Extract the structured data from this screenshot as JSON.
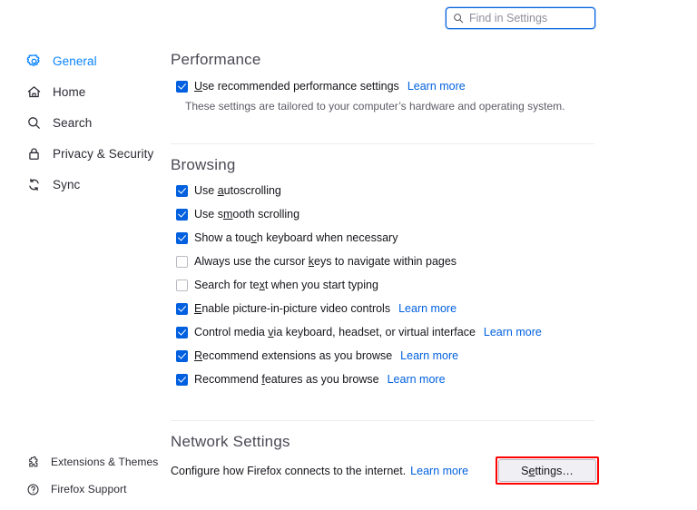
{
  "search": {
    "placeholder": "Find in Settings",
    "value": "",
    "icon": "search-icon"
  },
  "sidebar": {
    "items": [
      {
        "label": "General",
        "icon": "gear-icon",
        "active": true
      },
      {
        "label": "Home",
        "icon": "home-icon",
        "active": false
      },
      {
        "label": "Search",
        "icon": "search-icon",
        "active": false
      },
      {
        "label": "Privacy & Security",
        "icon": "lock-icon",
        "active": false
      },
      {
        "label": "Sync",
        "icon": "sync-icon",
        "active": false
      }
    ],
    "bottom_items": [
      {
        "label": "Extensions & Themes",
        "icon": "puzzle-piece-icon"
      },
      {
        "label": "Firefox Support",
        "icon": "question-circle-icon"
      }
    ]
  },
  "performance": {
    "heading": "Performance",
    "checkbox": {
      "label_pre": "",
      "accesskey": "U",
      "label_post": "se recommended performance settings",
      "checked": true,
      "learn_more": "Learn more"
    },
    "description": "These settings are tailored to your computer’s hardware and operating system."
  },
  "browsing": {
    "heading": "Browsing",
    "options": [
      {
        "pre": "Use ",
        "accesskey": "a",
        "post": "utoscrolling",
        "checked": true,
        "learn_more": ""
      },
      {
        "pre": "Use s",
        "accesskey": "m",
        "post": "ooth scrolling",
        "checked": true,
        "learn_more": ""
      },
      {
        "pre": "Show a tou",
        "accesskey": "c",
        "post": "h keyboard when necessary",
        "checked": true,
        "learn_more": ""
      },
      {
        "pre": "Always use the cursor ",
        "accesskey": "k",
        "post": "eys to navigate within pages",
        "checked": false,
        "learn_more": ""
      },
      {
        "pre": "Search for te",
        "accesskey": "x",
        "post": "t when you start typing",
        "checked": false,
        "learn_more": ""
      },
      {
        "pre": "",
        "accesskey": "E",
        "post": "nable picture-in-picture video controls",
        "checked": true,
        "learn_more": "Learn more"
      },
      {
        "pre": "Control media ",
        "accesskey": "v",
        "post": "ia keyboard, headset, or virtual interface",
        "checked": true,
        "learn_more": "Learn more"
      },
      {
        "pre": "",
        "accesskey": "R",
        "post": "ecommend extensions as you browse",
        "checked": true,
        "learn_more": "Learn more"
      },
      {
        "pre": "Recommend ",
        "accesskey": "f",
        "post": "eatures as you browse",
        "checked": true,
        "learn_more": "Learn more"
      }
    ]
  },
  "network": {
    "heading": "Network Settings",
    "description": "Configure how Firefox connects to the internet.",
    "learn_more": "Learn more",
    "button": {
      "pre": "S",
      "accesskey": "e",
      "post": "ttings…",
      "highlighted": true
    }
  },
  "colors": {
    "accent": "#0060df",
    "active_nav": "#0a84ff",
    "link": "#0060df",
    "highlight_outline": "#ff0000",
    "heading": "#4a4a55",
    "divider": "#ededf0"
  }
}
